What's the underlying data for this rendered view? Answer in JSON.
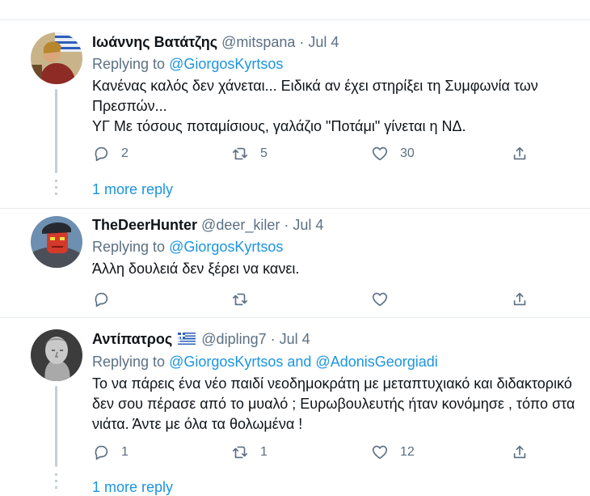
{
  "tweets": [
    {
      "name": "Ιωάννης Βατάτζης",
      "handle": "@mitspana",
      "time": "Jul 4",
      "replying_prefix": "Replying to ",
      "replying_to": "@GiorgosKyrtsos",
      "body": "Κανένας καλός δεν χάνεται... Ειδικά αν έχει στηρίξει τη Συμφωνία των Πρεσπών...\nΥΓ Με τόσους ποταμίσιους, γαλάζιο \"Ποτάμι\" γίνεται η ΝΔ.",
      "reply_count": "2",
      "retweet_count": "5",
      "like_count": "30",
      "more_reply": "1 more reply"
    },
    {
      "name": "TheDeerHunter",
      "handle": "@deer_kiler",
      "time": "Jul 4",
      "replying_prefix": "Replying to ",
      "replying_to": "@GiorgosKyrtsos",
      "body": "Άλλη δουλειά δεν ξέρει να κανει.",
      "reply_count": "",
      "retweet_count": "",
      "like_count": ""
    },
    {
      "name": "Αντίπατρος",
      "handle": "@dipling7",
      "time": "Jul 4",
      "replying_prefix": "Replying to ",
      "replying_to": "@GiorgosKyrtsos",
      "and": " and ",
      "replying_to_2": "@AdonisGeorgiadi",
      "body": "Το να πάρεις ένα νέο παιδί νεοδημοκράτη με μεταπτυχιακό και διδακτορικό δεν σου πέρασε από το μυαλό ; Ευρωβουλευτής ήταν κονόμησε , τόπο στα νιάτα. Άντε με όλα τα θολωμένα !",
      "reply_count": "1",
      "retweet_count": "1",
      "like_count": "12",
      "more_reply": "1 more reply"
    }
  ],
  "separator": " · "
}
